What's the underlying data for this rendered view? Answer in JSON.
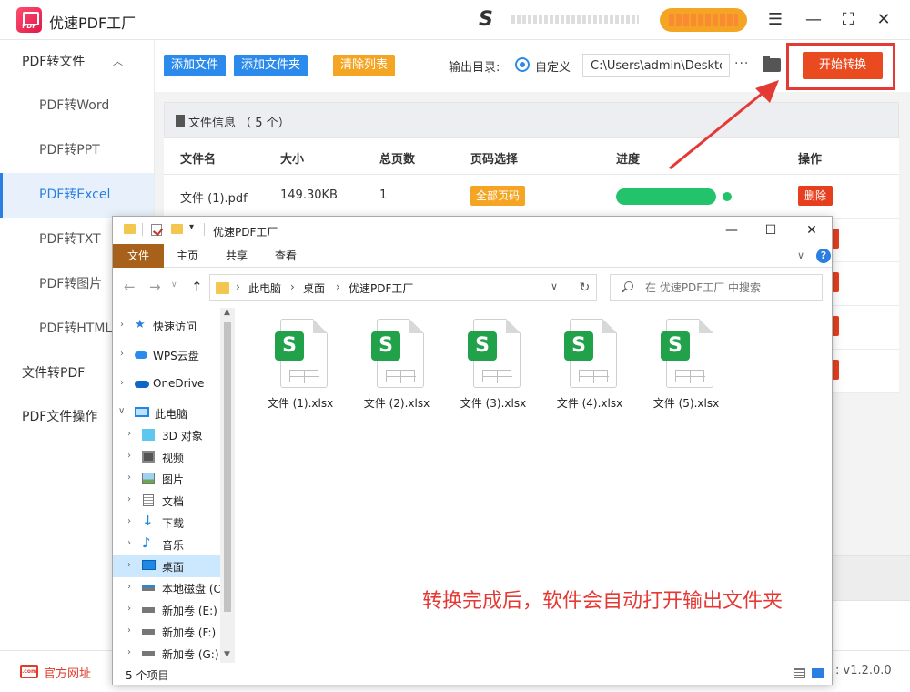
{
  "app": {
    "title": "优速PDF工厂",
    "logo_text": "PDF",
    "window_controls": [
      "menu-icon",
      "minimize-icon",
      "maximize-icon",
      "close-icon"
    ]
  },
  "sidebar": {
    "groups": [
      {
        "label": "PDF转文件",
        "expanded": true,
        "items": [
          "PDF转Word",
          "PDF转PPT",
          "PDF转Excel",
          "PDF转TXT",
          "PDF转图片",
          "PDF转HTML"
        ]
      },
      {
        "label": "文件转PDF"
      },
      {
        "label": "PDF文件操作"
      }
    ],
    "active_item": "PDF转Excel"
  },
  "toolbar": {
    "add_file": "添加文件",
    "add_folder": "添加文件夹",
    "clear_list": "清除列表",
    "output_dir_label": "输出目录:",
    "custom_option": "自定义",
    "output_path": "C:\\Users\\admin\\Desktop",
    "more": "···",
    "start": "开始转换"
  },
  "file_table": {
    "info_label": "文件信息 （ 5 个）",
    "headers": [
      "文件名",
      "大小",
      "总页数",
      "页码选择",
      "进度",
      "操作"
    ],
    "rows": [
      {
        "name": "文件 (1).pdf",
        "size": "149.30KB",
        "pages": "1",
        "page_select": "全部页码",
        "progress": 1.0,
        "action": "删除"
      }
    ]
  },
  "explorer": {
    "title": "优速PDF工厂",
    "ribbon_tabs": [
      "文件",
      "主页",
      "共享",
      "查看"
    ],
    "breadcrumb": [
      "此电脑",
      "桌面",
      "优速PDF工厂"
    ],
    "search_placeholder": "在 优速PDF工厂 中搜索",
    "help": "?",
    "tree": [
      {
        "label": "快速访问",
        "icon": "star-icon",
        "level": 0
      },
      {
        "label": "WPS云盘",
        "icon": "cloud-icon",
        "level": 0
      },
      {
        "label": "OneDrive",
        "icon": "onedrive-icon",
        "level": 0
      },
      {
        "label": "此电脑",
        "icon": "computer-icon",
        "level": 0,
        "expanded": true
      },
      {
        "label": "3D 对象",
        "icon": "cube-icon",
        "level": 1
      },
      {
        "label": "视频",
        "icon": "video-icon",
        "level": 1
      },
      {
        "label": "图片",
        "icon": "picture-icon",
        "level": 1
      },
      {
        "label": "文档",
        "icon": "document-icon",
        "level": 1
      },
      {
        "label": "下载",
        "icon": "download-icon",
        "level": 1
      },
      {
        "label": "音乐",
        "icon": "music-icon",
        "level": 1
      },
      {
        "label": "桌面",
        "icon": "desktop-icon",
        "level": 1,
        "selected": true
      },
      {
        "label": "本地磁盘 (C",
        "icon": "drive-icon",
        "level": 1
      },
      {
        "label": "新加卷 (E:)",
        "icon": "drive-icon",
        "level": 1
      },
      {
        "label": "新加卷 (F:)",
        "icon": "drive-icon",
        "level": 1
      },
      {
        "label": "新加卷 (G:)",
        "icon": "drive-icon",
        "level": 1
      }
    ],
    "files": [
      "文件 (1).xlsx",
      "文件 (2).xlsx",
      "文件 (3).xlsx",
      "文件 (4).xlsx",
      "文件 (5).xlsx"
    ],
    "file_badge": "S",
    "status": "5 个项目"
  },
  "overlay_message": "转换完成后，软件会自动打开输出文件夹",
  "footer": {
    "site_icon_text": ".com",
    "site_link": "官方网址",
    "version": ": v1.2.0.0"
  },
  "colors": {
    "primary_blue": "#2b8aeb",
    "orange": "#f5a524",
    "start_button": "#ea4a1f",
    "annotation_red": "#e53935",
    "progress_green": "#22c36a",
    "excel_green": "#21a24a",
    "explorer_file_tab": "#a8611a"
  }
}
